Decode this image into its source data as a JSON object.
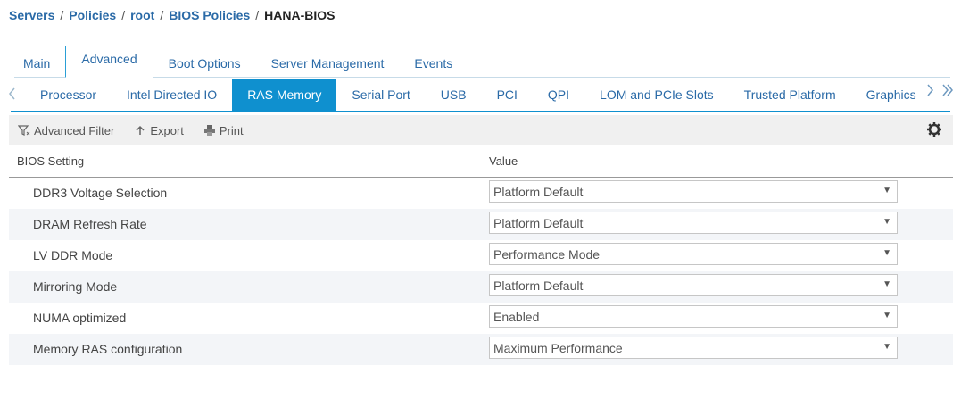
{
  "breadcrumb": {
    "items": [
      "Servers",
      "Policies",
      "root",
      "BIOS Policies"
    ],
    "current": "HANA-BIOS",
    "separator": "/"
  },
  "main_tabs": [
    {
      "label": "Main"
    },
    {
      "label": "Advanced",
      "active": true
    },
    {
      "label": "Boot Options"
    },
    {
      "label": "Server Management"
    },
    {
      "label": "Events"
    }
  ],
  "sub_tabs": [
    {
      "label": "Processor"
    },
    {
      "label": "Intel Directed IO"
    },
    {
      "label": "RAS Memory",
      "active": true
    },
    {
      "label": "Serial Port"
    },
    {
      "label": "USB"
    },
    {
      "label": "PCI"
    },
    {
      "label": "QPI"
    },
    {
      "label": "LOM and PCIe Slots"
    },
    {
      "label": "Trusted Platform"
    },
    {
      "label": "Graphics"
    }
  ],
  "toolbar": {
    "filter_label": "Advanced Filter",
    "export_label": "Export",
    "print_label": "Print"
  },
  "table": {
    "headers": {
      "setting": "BIOS Setting",
      "value": "Value"
    },
    "rows": [
      {
        "setting": "DDR3 Voltage Selection",
        "value": "Platform Default"
      },
      {
        "setting": "DRAM Refresh Rate",
        "value": "Platform Default"
      },
      {
        "setting": "LV DDR Mode",
        "value": "Performance Mode"
      },
      {
        "setting": "Mirroring Mode",
        "value": "Platform Default"
      },
      {
        "setting": "NUMA optimized",
        "value": "Enabled"
      },
      {
        "setting": "Memory RAS configuration",
        "value": "Maximum Performance"
      }
    ]
  },
  "colors": {
    "accent": "#0f90cf",
    "link": "#2a6aa7"
  },
  "icons": [
    "filter-icon",
    "export-icon",
    "print-icon",
    "gear-icon",
    "chevron-left-icon",
    "chevron-right-icon",
    "caret-down-icon"
  ]
}
